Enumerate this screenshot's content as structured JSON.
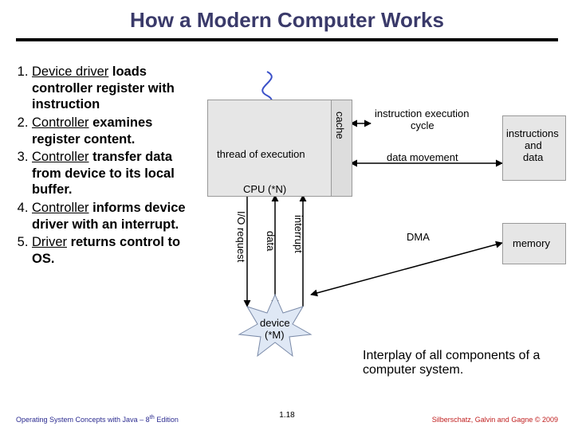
{
  "title": "How a Modern Computer Works",
  "steps": [
    {
      "u": "Device driver",
      "b": " loads controller register with instruction"
    },
    {
      "u": "Controller",
      "b": " examines register content."
    },
    {
      "u": "Controller",
      "b": " transfer data from device to its local buffer."
    },
    {
      "u": "Controller",
      "b": " informs device driver with an interrupt."
    },
    {
      "u": "Driver",
      "b": " returns control to OS."
    }
  ],
  "diagram": {
    "thread": "thread of execution",
    "cache": "cache",
    "cpu": "CPU (*N)",
    "iec_line1": "instruction execution",
    "iec_line2": "cycle",
    "data_movement": "data movement",
    "instr_line1": "instructions",
    "instr_line2": "and",
    "instr_line3": "data",
    "io_request": "I/O request",
    "data": "data",
    "interrupt": "interrupt",
    "dma": "DMA",
    "memory": "memory",
    "device_line1": "device",
    "device_line2": "(*M)"
  },
  "caption": "Interplay of all components of a computer system.",
  "footer": {
    "left": "Operating System Concepts with Java – 8th Edition",
    "left_plain": "Operating System Concepts with Java – 8",
    "left_sup": "th",
    "left_tail": " Edition",
    "center": "1.18",
    "right": "Silberschatz, Galvin and Gagne © 2009"
  }
}
